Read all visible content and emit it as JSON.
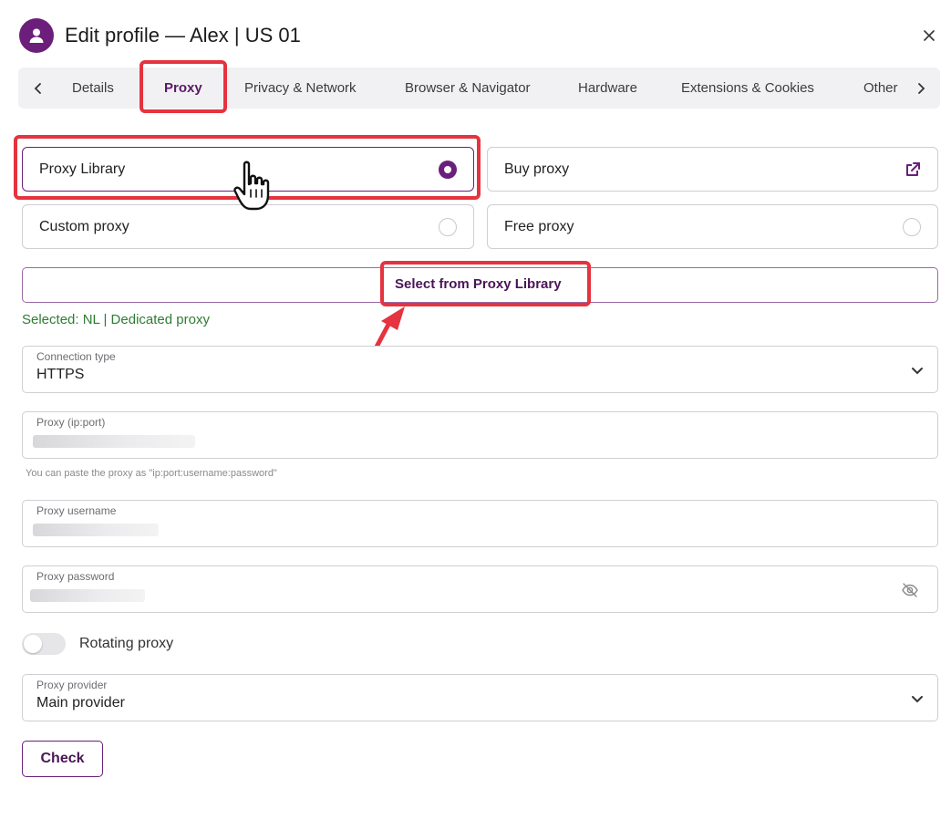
{
  "header": {
    "title": "Edit profile — Alex | US 01",
    "avatar_icon": "user-icon",
    "close_icon": "close-icon"
  },
  "tabs": [
    {
      "label": "Details",
      "active": false
    },
    {
      "label": "Proxy",
      "active": true
    },
    {
      "label": "Privacy & Network",
      "active": false
    },
    {
      "label": "Browser & Navigator",
      "active": false
    },
    {
      "label": "Hardware",
      "active": false
    },
    {
      "label": "Extensions & Cookies",
      "active": false
    },
    {
      "label": "Other",
      "active": false
    }
  ],
  "proxy_options": {
    "library": {
      "label": "Proxy Library",
      "selected": true
    },
    "buy": {
      "label": "Buy proxy",
      "icon": "external-link-icon"
    },
    "custom": {
      "label": "Custom proxy",
      "selected": false
    },
    "free": {
      "label": "Free proxy",
      "selected": false
    }
  },
  "library_button": "Select from Proxy Library",
  "selected_note": "Selected: NL | Dedicated proxy",
  "fields": {
    "connection_type": {
      "label": "Connection type",
      "value": "HTTPS"
    },
    "proxy_ip_port": {
      "label": "Proxy (ip:port)"
    },
    "hint": "You can paste the proxy as \"ip:port:username:password\"",
    "proxy_username": {
      "label": "Proxy username"
    },
    "proxy_password": {
      "label": "Proxy password"
    },
    "rotating": {
      "label": "Rotating proxy",
      "enabled": false
    },
    "proxy_provider": {
      "label": "Proxy provider",
      "value": "Main provider"
    }
  },
  "check_button": "Check",
  "colors": {
    "accent": "#6b1f7a",
    "highlight": "#e5333f",
    "success_text": "#2e7d32"
  }
}
